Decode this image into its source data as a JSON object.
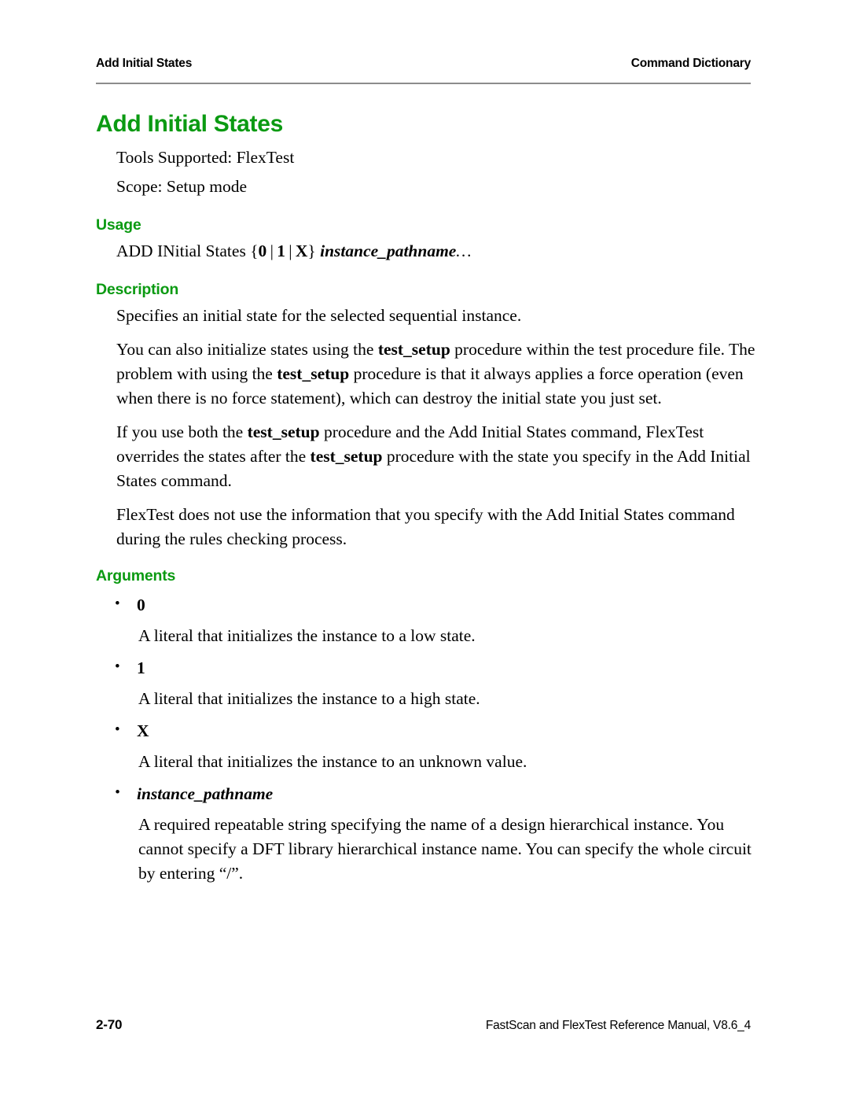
{
  "theme": {
    "heading_green": "#0b9a12",
    "rule_gray": "#8c8c8c",
    "text_black": "#000000"
  },
  "running_header": {
    "left": "Add Initial States",
    "right": "Command Dictionary"
  },
  "title": "Add Initial States",
  "intro": {
    "tools_supported": "Tools Supported: FlexTest",
    "scope": "Scope: Setup mode"
  },
  "usage": {
    "heading": "Usage",
    "command": "ADD INitial States",
    "brace_open": "{",
    "choice_0": "0",
    "sep1": "|",
    "choice_1": "1",
    "sep2": "|",
    "choice_x": "X",
    "brace_close": "}",
    "argument": "instance_pathname",
    "ellipsis": "…"
  },
  "description": {
    "heading": "Description",
    "paragraphs": [
      {
        "parts": [
          {
            "text": "Specifies an initial state for the selected sequential instance.",
            "style": "normal"
          }
        ]
      },
      {
        "parts": [
          {
            "text": "You can also initialize states using the ",
            "style": "normal"
          },
          {
            "text": "test_setup",
            "style": "bold"
          },
          {
            "text": " procedure within the test procedure file. The problem with using the ",
            "style": "normal"
          },
          {
            "text": "test_setup",
            "style": "bold"
          },
          {
            "text": " procedure is that it always applies a force operation (even when there is no force statement), which can destroy the initial state you just set.",
            "style": "normal"
          }
        ]
      },
      {
        "parts": [
          {
            "text": "If you use both the ",
            "style": "normal"
          },
          {
            "text": "test_setup",
            "style": "bold"
          },
          {
            "text": " procedure and the Add Initial States command, FlexTest overrides the states after the ",
            "style": "normal"
          },
          {
            "text": "test_setup",
            "style": "bold"
          },
          {
            "text": " procedure with the state you specify in the Add Initial States command.",
            "style": "normal"
          }
        ]
      },
      {
        "parts": [
          {
            "text": "FlexTest does not use the information that you specify with the Add Initial States command during the rules checking process.",
            "style": "normal"
          }
        ]
      }
    ]
  },
  "arguments": {
    "heading": "Arguments",
    "items": [
      {
        "term": "0",
        "term_style": "bold",
        "description": "A literal that initializes the instance to a low state."
      },
      {
        "term": "1",
        "term_style": "bold",
        "description": "A literal that initializes the instance to a high state."
      },
      {
        "term": "X",
        "term_style": "bold",
        "description": "A literal that initializes the instance to an unknown value."
      },
      {
        "term": "instance_pathname",
        "term_style": "bold-italic",
        "description": "A required repeatable string specifying the name of a design hierarchical instance. You cannot specify a DFT library hierarchical instance name. You can specify the whole circuit by entering “/”."
      }
    ]
  },
  "footer": {
    "page_number": "2-70",
    "manual": "FastScan and FlexTest Reference Manual, V8.6_4"
  }
}
